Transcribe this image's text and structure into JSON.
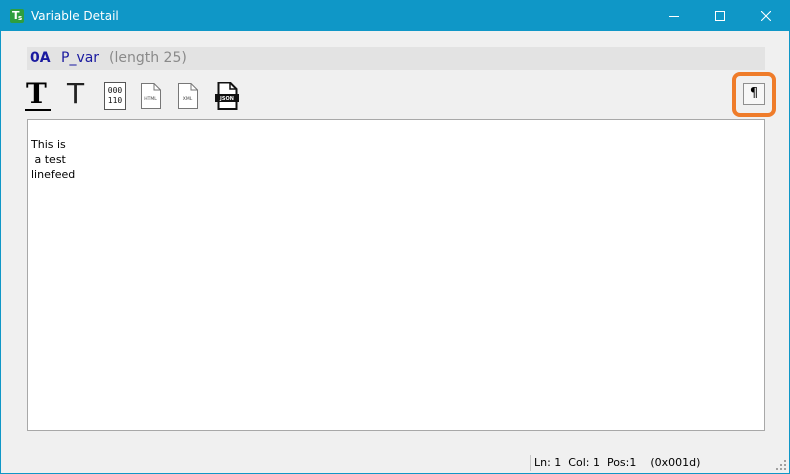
{
  "window": {
    "title": "Variable Detail",
    "icon": "app-t-icon"
  },
  "variable": {
    "code": "0A",
    "name": "P_var",
    "length_text": "(length 25)"
  },
  "toolbar": {
    "bold_text_glyph": "T",
    "plain_text_glyph": "T",
    "binary_top": "000",
    "binary_bottom": "110",
    "html_label": "HTML",
    "xml_label": "XML",
    "json_label": "JSON",
    "paragraph_glyph": "¶"
  },
  "editor": {
    "content": "This is\n a test\nlinefeed"
  },
  "status": {
    "text": "Ln: 1  Col: 1  Pos:1    (0x001d)"
  },
  "colors": {
    "titlebar": "#0f97c7",
    "highlight": "#ef7c2a",
    "variable_text": "#1a1aa0"
  }
}
